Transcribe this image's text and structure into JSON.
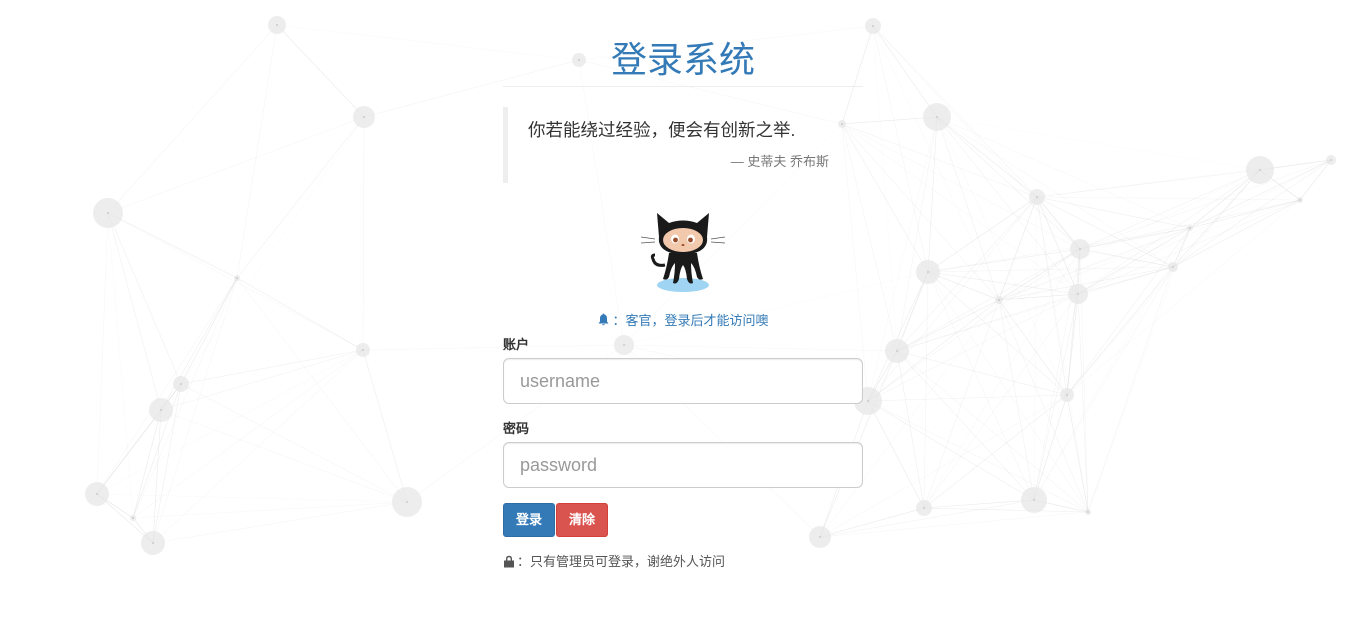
{
  "page": {
    "title": "登录系统",
    "quote": {
      "text": "你若能绕过经验，便会有创新之举.",
      "author": "— 史蒂夫 乔布斯"
    },
    "hint": "：客官，登录后才能访问噢",
    "form": {
      "username_label": "账户",
      "username_placeholder": "username",
      "username_value": "",
      "password_label": "密码",
      "password_placeholder": "password",
      "password_value": "",
      "login_label": "登录",
      "clear_label": "清除"
    },
    "footer_note": "：只有管理员可登录，谢绝外人访问"
  },
  "icons": {
    "hint": "bell-icon",
    "footer": "lock-icon",
    "mascot": "octocat-logo"
  },
  "colors": {
    "primary": "#337ab7",
    "danger": "#d9534f",
    "text": "#333333",
    "muted": "#777777"
  }
}
